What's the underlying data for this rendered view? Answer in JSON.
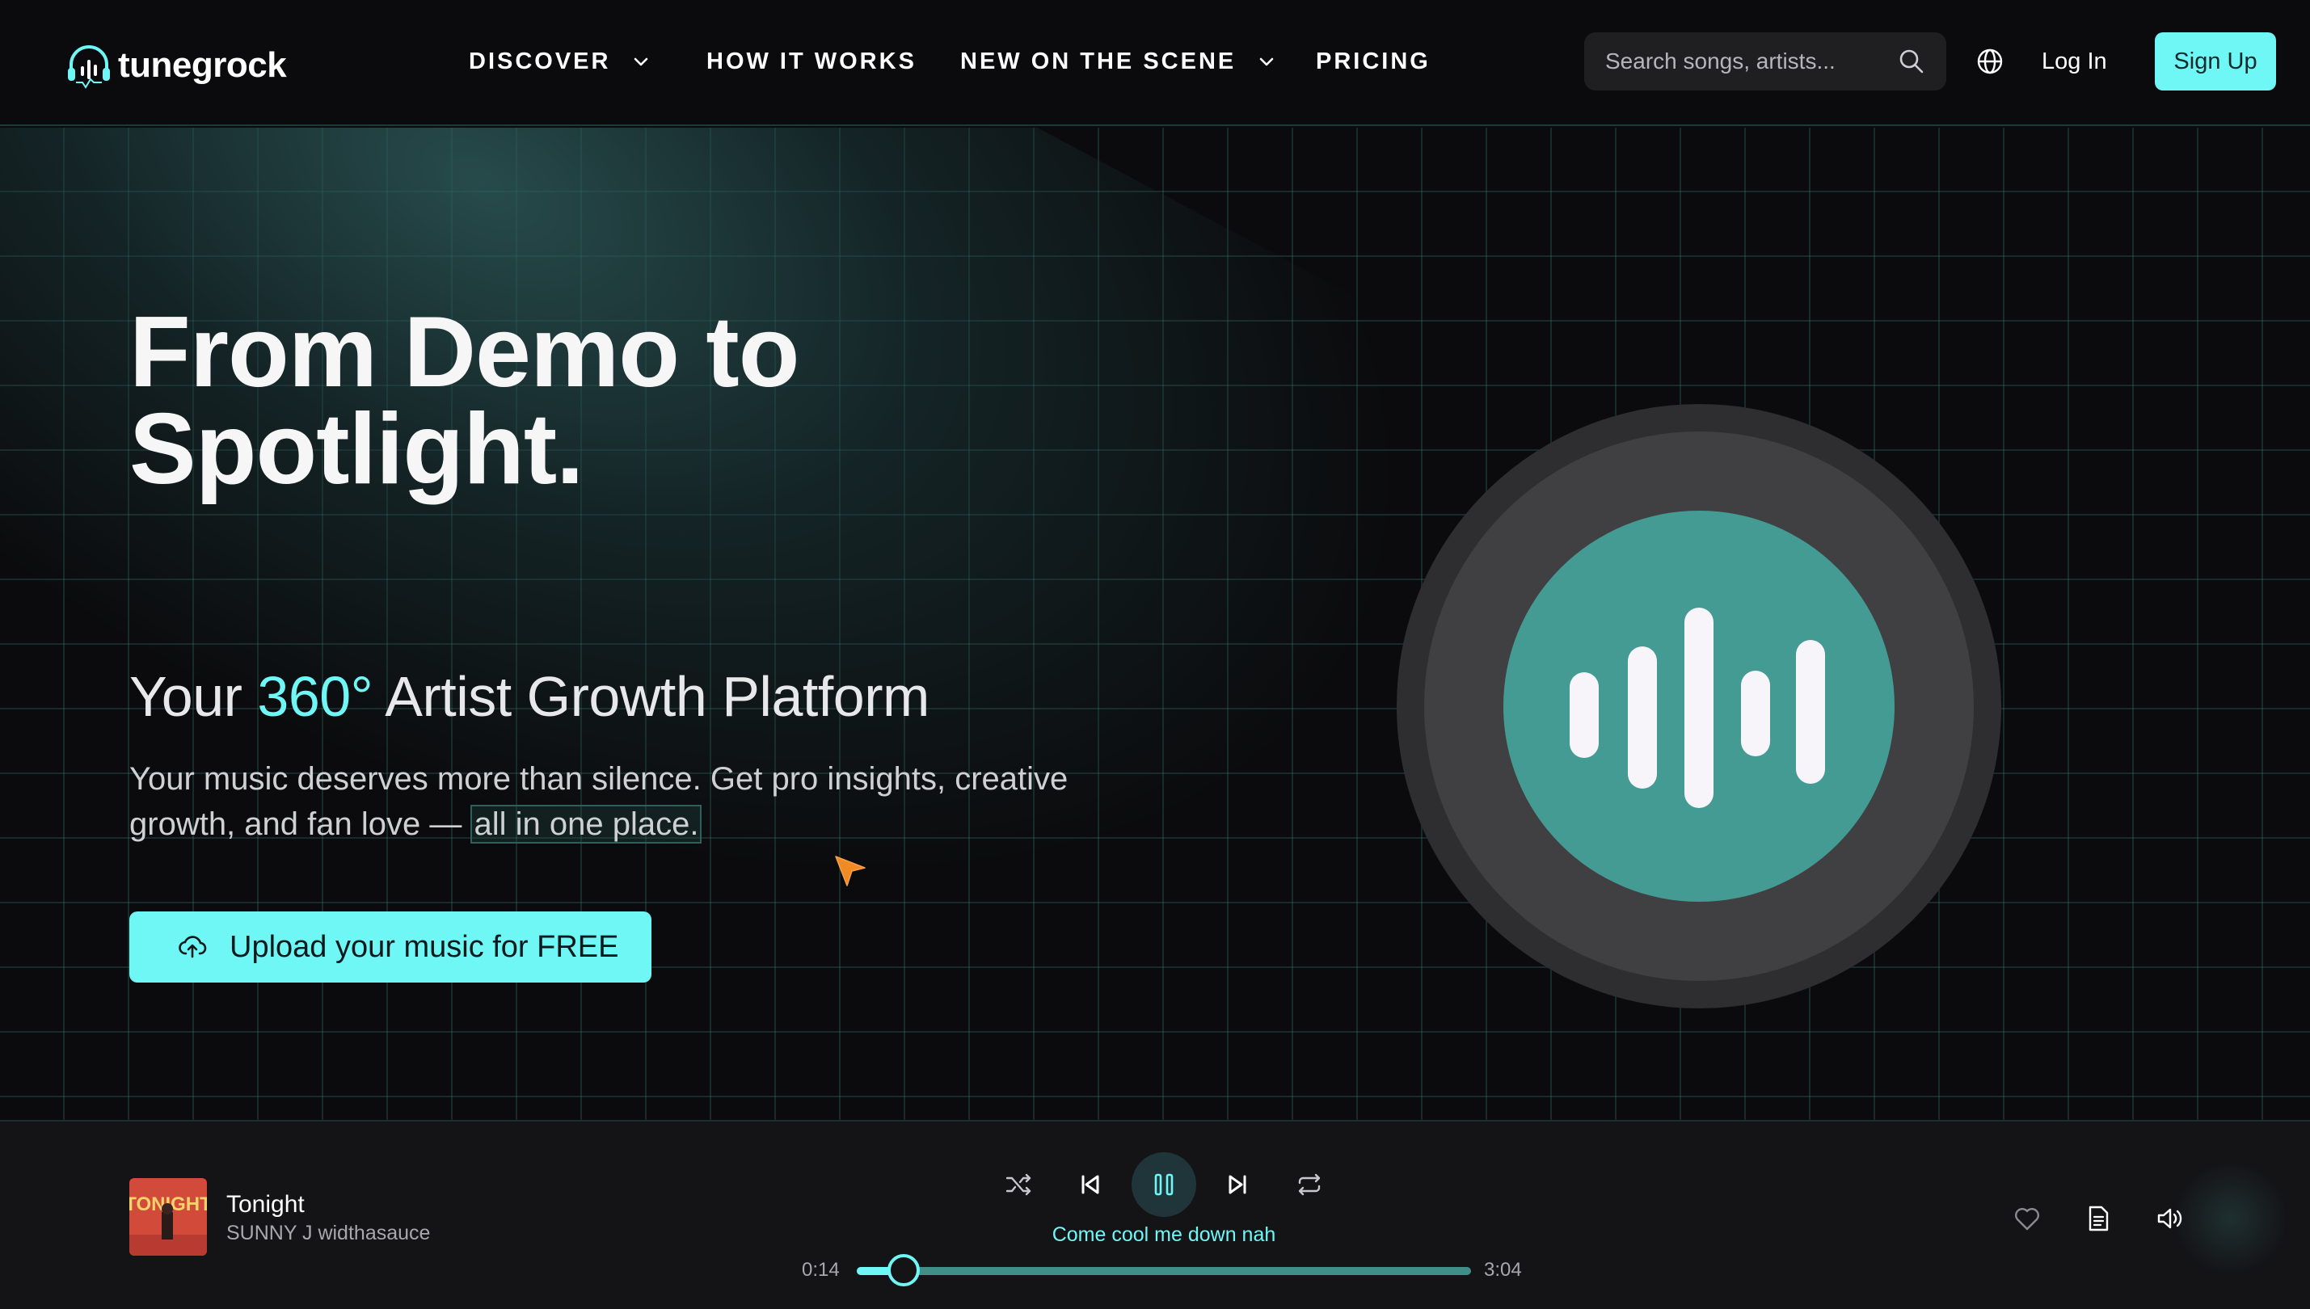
{
  "header": {
    "logo_text": "tunegrock",
    "nav": [
      {
        "label": "DISCOVER",
        "has_dropdown": true
      },
      {
        "label": "HOW IT WORKS",
        "has_dropdown": false
      },
      {
        "label": "NEW ON THE SCENE",
        "has_dropdown": true
      },
      {
        "label": "PRICING",
        "has_dropdown": false
      }
    ],
    "search_placeholder": "Search songs, artists...",
    "login_label": "Log In",
    "signup_label": "Sign Up"
  },
  "hero": {
    "title": "From Demo to Spotlight.",
    "subtitle_pre": "Your ",
    "subtitle_accent": "360°",
    "subtitle_post": " Artist Growth Platform",
    "desc_main": "Your music deserves more than silence. Get pro insights, creative growth, and fan love — ",
    "desc_highlight": "all in one place.",
    "cta_label": "Upload your music for FREE"
  },
  "player": {
    "track_title": "Tonight",
    "artist": "SUNNY J widthasauce",
    "cover_text": "TONIGHT",
    "lyric": "Come cool me down nah",
    "current_time": "0:14",
    "total_time": "3:04",
    "progress": 0.076,
    "is_playing": true
  },
  "icons": {
    "logo": "headphones-waveform-icon",
    "search": "search-icon",
    "globe": "globe-icon",
    "cta": "cloud-upload-icon",
    "shuffle": "shuffle-icon",
    "previous": "skip-previous-icon",
    "pause": "pause-icon",
    "next": "skip-next-icon",
    "repeat": "repeat-icon",
    "like": "heart-icon",
    "lyrics": "document-icon",
    "volume": "volume-icon"
  },
  "colors": {
    "accent": "#6ff7f6",
    "background": "#0b0b0d",
    "disc_center": "#449b93",
    "player_bg": "#141417"
  }
}
